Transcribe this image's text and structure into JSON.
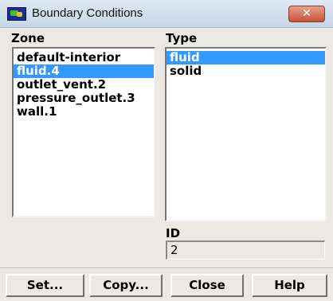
{
  "window": {
    "title": "Boundary Conditions",
    "close_glyph": "✕"
  },
  "zone": {
    "label": "Zone",
    "items": [
      "default-interior",
      "fluid.4",
      "outlet_vent.2",
      "pressure_outlet.3",
      "wall.1"
    ],
    "selected": "fluid.4"
  },
  "type": {
    "label": "Type",
    "items": [
      "fluid",
      "solid"
    ],
    "selected": "fluid"
  },
  "id": {
    "label": "ID",
    "value": "2"
  },
  "buttons": {
    "set": "Set...",
    "copy": "Copy...",
    "close": "Close",
    "help": "Help"
  },
  "colors": {
    "selection": "#3399ff",
    "dialog_bg": "#ece9e4",
    "close_button": "#c6533a"
  }
}
